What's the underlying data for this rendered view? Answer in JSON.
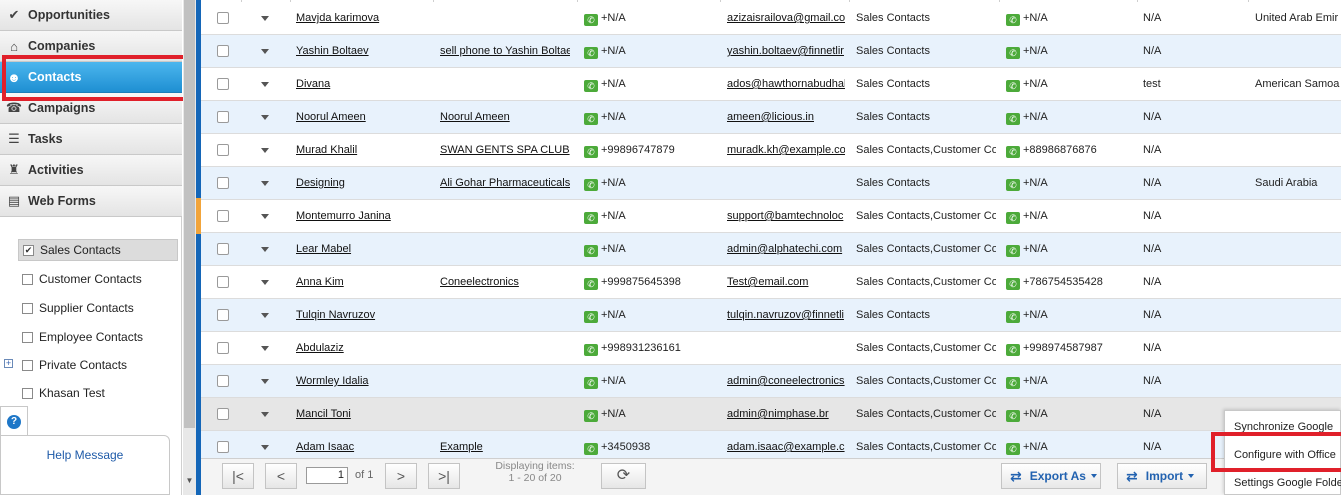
{
  "sidebar": {
    "nav": [
      {
        "label": "Opportunities",
        "icon": "check-icon"
      },
      {
        "label": "Companies",
        "icon": "house-icon"
      },
      {
        "label": "Contacts",
        "icon": "person-icon",
        "active": true
      },
      {
        "label": "Campaigns",
        "icon": "campaign-icon"
      },
      {
        "label": "Tasks",
        "icon": "list-icon"
      },
      {
        "label": "Activities",
        "icon": "walk-icon"
      },
      {
        "label": "Web Forms",
        "icon": "form-icon"
      }
    ],
    "filters": [
      {
        "label": "Sales Contacts",
        "checked": true
      },
      {
        "label": "Customer Contacts",
        "checked": false
      },
      {
        "label": "Supplier Contacts",
        "checked": false
      },
      {
        "label": "Employee Contacts",
        "checked": false
      },
      {
        "label": "Private Contacts",
        "checked": false
      },
      {
        "label": "Khasan Test",
        "checked": false
      }
    ],
    "expand_glyph": "+",
    "help_icon_glyph": "?",
    "help_label": "Help Message"
  },
  "grid": {
    "rows": [
      {
        "name": "Mavjda karimova",
        "account": "",
        "phone": "+N/A",
        "email": "azizaisrailova@gmail.co",
        "type": "Sales Contacts",
        "mobile": "+N/A",
        "status": "N/A",
        "country": "United Arab Emir"
      },
      {
        "name": "Yashin Boltaev",
        "account": "sell phone to Yashin Boltae",
        "phone": "+N/A",
        "email": "yashin.boltaev@finnetlir",
        "type": "Sales Contacts",
        "mobile": "+N/A",
        "status": "N/A",
        "country": ""
      },
      {
        "name": "Divana",
        "account": "",
        "phone": "+N/A",
        "email": "ados@hawthornabudhal",
        "type": "Sales Contacts",
        "mobile": "+N/A",
        "status": "test",
        "country": "American Samoa"
      },
      {
        "name": "Noorul Ameen",
        "account": "Noorul Ameen",
        "phone": "+N/A",
        "email": "ameen@licious.in",
        "type": "Sales Contacts",
        "mobile": "+N/A",
        "status": "N/A",
        "country": ""
      },
      {
        "name": "Murad Khalil",
        "account": "SWAN GENTS SPA CLUB",
        "phone": "+99896747879",
        "email": "muradk.kh@example.co",
        "type": "Sales Contacts,Customer Co",
        "mobile": "+88986876876",
        "status": "N/A",
        "country": ""
      },
      {
        "name": "Designing",
        "account": "Ali Gohar Pharmaceuticals",
        "phone": "+N/A",
        "email": "",
        "type": "Sales Contacts",
        "mobile": "+N/A",
        "status": "N/A",
        "country": "Saudi Arabia"
      },
      {
        "name": "Montemurro Janina",
        "account": "",
        "phone": "+N/A",
        "email": "support@bamtechnoloc",
        "type": "Sales Contacts,Customer Co",
        "mobile": "+N/A",
        "status": "N/A",
        "country": ""
      },
      {
        "name": "Lear Mabel",
        "account": "",
        "phone": "+N/A",
        "email": "admin@alphatechi.com",
        "type": "Sales Contacts,Customer Co",
        "mobile": "+N/A",
        "status": "N/A",
        "country": ""
      },
      {
        "name": "Anna Kim",
        "account": "Coneelectronics",
        "phone": "+999875645398",
        "email": "Test@email.com",
        "type": "Sales Contacts,Customer Co",
        "mobile": "+786754535428",
        "status": "N/A",
        "country": ""
      },
      {
        "name": "Tulqin Navruzov",
        "account": "",
        "phone": "+N/A",
        "email": "tulqin.navruzov@finnetli",
        "type": "Sales Contacts",
        "mobile": "+N/A",
        "status": "N/A",
        "country": ""
      },
      {
        "name": "Abdulaziz",
        "account": "",
        "phone": "+998931236161",
        "email": "",
        "type": "Sales Contacts,Customer Co",
        "mobile": "+998974587987",
        "status": "N/A",
        "country": ""
      },
      {
        "name": "Wormley Idalia",
        "account": "",
        "phone": "+N/A",
        "email": "admin@coneelectronics",
        "type": "Sales Contacts,Customer Co",
        "mobile": "+N/A",
        "status": "N/A",
        "country": ""
      },
      {
        "name": "Mancil Toni",
        "account": "",
        "phone": "+N/A",
        "email": "admin@nimphase.br",
        "type": "Sales Contacts,Customer Co",
        "mobile": "+N/A",
        "status": "N/A",
        "country": ""
      },
      {
        "name": "Adam Isaac",
        "account": "Example",
        "phone": "+3450938",
        "email": "adam.isaac@example.c",
        "type": "Sales Contacts,Customer Co",
        "mobile": "+N/A",
        "status": "N/A",
        "country": ""
      }
    ]
  },
  "pager": {
    "first_glyph": "|<",
    "prev_glyph": "<",
    "page_value": "1",
    "of_label": "of 1",
    "next_glyph": ">",
    "last_glyph": ">|",
    "displaying_line1": "Displaying items:",
    "displaying_line2": "1 - 20 of 20",
    "refresh_glyph": "⟳",
    "export_label": "Export As",
    "import_label": "Import"
  },
  "menu": {
    "items": [
      "Synchronize Google",
      "Configure with Office",
      "Settings Google Folde"
    ]
  },
  "colors": {
    "accent": "#1e8fd2",
    "highlight_red": "#e0202a",
    "phone_green": "#4caa3a",
    "row_alt": "#e8f2fc"
  }
}
